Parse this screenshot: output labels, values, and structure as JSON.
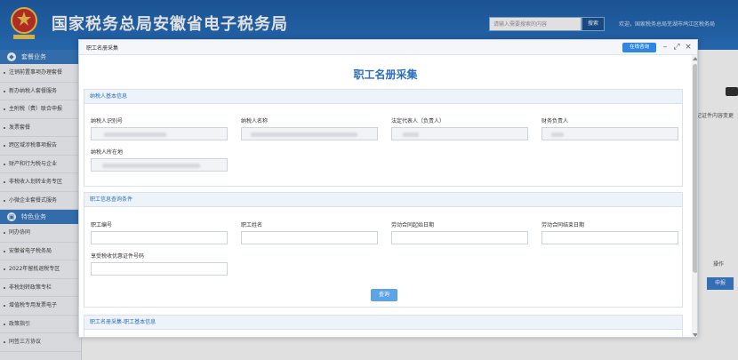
{
  "header": {
    "site_title": "国家税务总局安徽省电子税务局",
    "search_placeholder": "请输入需要搜索的内容",
    "search_button": "搜索",
    "welcome": "欢迎，国家税务总局芜湖市鸠江区税务局"
  },
  "sidebar": {
    "categories": [
      {
        "label": "套餐业务",
        "items": [
          "注销前置事项办理套餐",
          "新办纳税人套餐服务",
          "主附税（费）联合申报",
          "发票套餐",
          "跨区域涉税事项报告",
          "财产和行为税与企业",
          "非税收入划转业务专区",
          "小微企业套餐式服务"
        ]
      },
      {
        "label": "特色业务",
        "items": [
          "同办协同",
          "安徽省电子税务局",
          "2022年留抵退税专区",
          "非税划转政策专栏",
          "增值税专用发票电子",
          "政策指引",
          "同签三方协议"
        ]
      }
    ]
  },
  "background": {
    "card_text": "记证件内容变更",
    "operations_label": "操作",
    "apply_button": "申报"
  },
  "modal": {
    "header_title": "职工名册采集",
    "online_help": "在线咨询",
    "form_title": "职工名册采集",
    "taxpayer_section": {
      "title": "纳税人基本信息",
      "fields": [
        {
          "label": "纳税人识别号"
        },
        {
          "label": "纳税人名称"
        },
        {
          "label": "法定代表人（负责人）"
        },
        {
          "label": "财务负责人"
        },
        {
          "label": "纳税人所在地"
        }
      ]
    },
    "query_section": {
      "title": "职工信息查询条件",
      "fields": [
        {
          "label": "职工编号",
          "value": ""
        },
        {
          "label": "职工姓名",
          "value": ""
        },
        {
          "label": "劳动合同起始日期",
          "value": ""
        },
        {
          "label": "劳动合同结束日期",
          "value": ""
        },
        {
          "label": "享受税收优惠证件号码",
          "value": ""
        }
      ],
      "query_button": "查询"
    },
    "list_section": {
      "title": "职工名册采集-职工基本信息"
    }
  }
}
